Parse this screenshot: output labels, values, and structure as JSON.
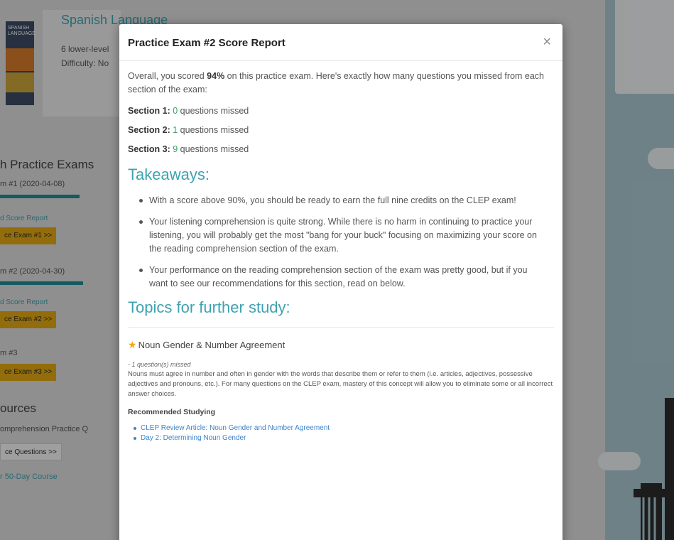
{
  "background": {
    "course_title": "Spanish Language",
    "course_line1": "6 lower-level",
    "course_line2": "Difficulty: No",
    "book_title": "SPANISH LANGUAGE",
    "practice_header": "h Practice Exams",
    "exam1_label": "m #1 (2020-04-08)",
    "exam1_pct": "90%",
    "exam1_progress": 0.9,
    "exam1_report": "d Score Report",
    "exam1_button": "ce Exam #1 >>",
    "exam2_label": "m #2 (2020-04-30)",
    "exam2_pct": "94%",
    "exam2_progress": 0.94,
    "exam2_report": "d Score Report",
    "exam2_button": "ce Exam #2 >>",
    "exam3_label": "m #3",
    "exam3_button": "ce Exam #3 >>",
    "resources_header": "ources",
    "resources_line": "omprehension Practice Q",
    "questions_button": "ce Questions >>",
    "course_link": "r 50-Day Course"
  },
  "modal": {
    "title": "Practice Exam #2 Score Report",
    "close_label": "×",
    "intro_before": "Overall, you scored ",
    "intro_score": "94%",
    "intro_after": " on this practice exam. Here's exactly how many questions you missed from each section of the exam:",
    "sections": [
      {
        "label": "Section 1:",
        "count": "0",
        "suffix": " questions missed"
      },
      {
        "label": "Section 2:",
        "count": "1",
        "suffix": " questions missed"
      },
      {
        "label": "Section 3:",
        "count": "9",
        "suffix": " questions missed"
      }
    ],
    "takeaways_heading": "Takeaways:",
    "takeaways": [
      "With a score above 90%, you should be ready to earn the full nine credits on the CLEP exam!",
      "Your listening comprehension is quite strong. While there is no harm in continuing to practice your listening, you will probably get the most \"bang for your buck\" focusing on maximizing your score on the reading comprehension section of the exam.",
      "Your performance on the reading comprehension section of the exam was pretty good, but if you want to see our recommendations for this section, read on below."
    ],
    "topics_heading": "Topics for further study:",
    "topic": {
      "title": "Noun Gender & Number Agreement",
      "missed": "- 1 question(s) missed",
      "description": "Nouns must agree in number and often in gender with the words that describe them or refer to them (i.e. articles, adjectives, possessive adjectives and pronouns, etc.). For many questions on the CLEP exam, mastery of this concept will allow you to eliminate some or all incorrect answer choices.",
      "recommended_label": "Recommended Studying",
      "links": [
        "CLEP Review Article: Noun Gender and Number Agreement",
        "Day 2: Determining Noun Gender"
      ]
    }
  },
  "colors": {
    "accent": "#3fa2b0",
    "success": "#3aa25f",
    "star": "#f0a912",
    "link": "#3f82c9",
    "button": "#e2a812"
  }
}
